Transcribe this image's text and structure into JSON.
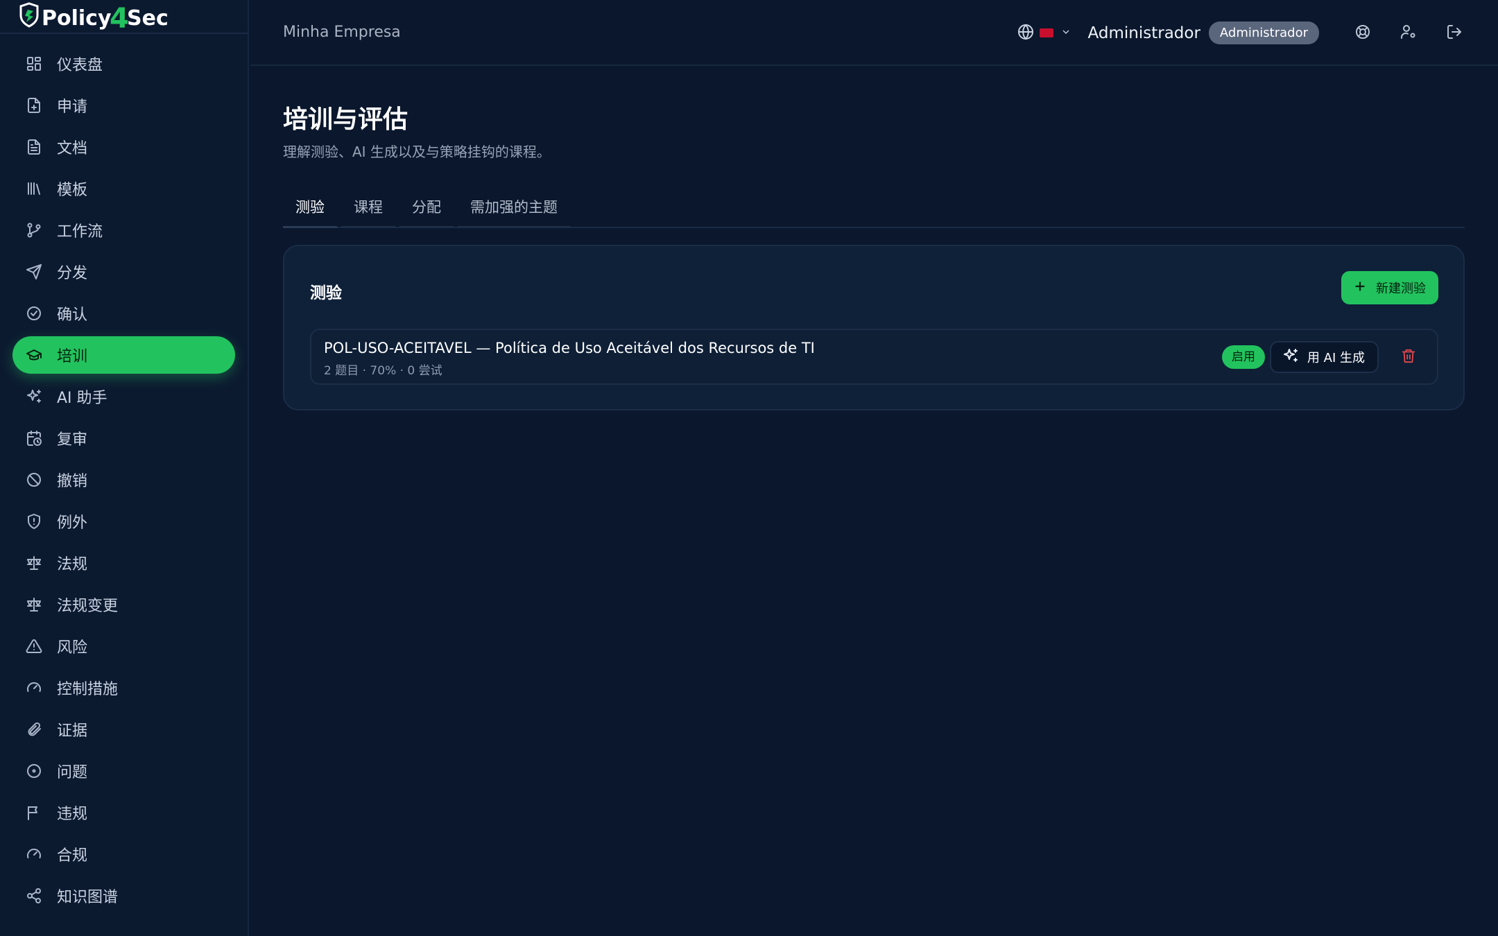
{
  "brand": {
    "name": "Policy4Sec",
    "part1": "Policy",
    "part2": "4",
    "part3": "Sec",
    "accent": "#22c35e"
  },
  "sidebar": {
    "items": [
      {
        "label": "仪表盘",
        "icon": "dashboard-icon"
      },
      {
        "label": "申请",
        "icon": "file-plus-icon"
      },
      {
        "label": "文档",
        "icon": "document-icon"
      },
      {
        "label": "模板",
        "icon": "library-icon"
      },
      {
        "label": "工作流",
        "icon": "git-branch-icon"
      },
      {
        "label": "分发",
        "icon": "send-icon"
      },
      {
        "label": "确认",
        "icon": "check-circle-icon"
      },
      {
        "label": "培训",
        "icon": "graduation-cap-icon",
        "active": true
      },
      {
        "label": "AI 助手",
        "icon": "sparkles-icon"
      },
      {
        "label": "复审",
        "icon": "calendar-clock-icon"
      },
      {
        "label": "撤销",
        "icon": "ban-icon"
      },
      {
        "label": "例外",
        "icon": "shield-alert-icon"
      },
      {
        "label": "法规",
        "icon": "scale-icon"
      },
      {
        "label": "法规变更",
        "icon": "scale-icon"
      },
      {
        "label": "风险",
        "icon": "warning-icon"
      },
      {
        "label": "控制措施",
        "icon": "gauge-icon"
      },
      {
        "label": "证据",
        "icon": "paperclip-icon"
      },
      {
        "label": "问题",
        "icon": "circle-dot-icon"
      },
      {
        "label": "违规",
        "icon": "flag-icon"
      },
      {
        "label": "合规",
        "icon": "gauge-icon"
      },
      {
        "label": "知识图谱",
        "icon": "share-icon"
      },
      {
        "label": "",
        "icon": "more-icon"
      }
    ]
  },
  "header": {
    "company": "Minha Empresa",
    "user_name": "Administrador",
    "role": "Administrador",
    "language_flag_color": "#c8102e"
  },
  "page": {
    "title": "培训与评估",
    "subtitle": "理解测验、AI 生成以及与策略挂钩的课程。"
  },
  "tabs": [
    {
      "label": "测验",
      "active": true
    },
    {
      "label": "课程"
    },
    {
      "label": "分配"
    },
    {
      "label": "需加强的主题"
    }
  ],
  "quizzes_card": {
    "title": "测验",
    "new_button": "新建测验",
    "items": [
      {
        "title": "POL-USO-ACEITAVEL — Política de Uso Aceitável dos Recursos de TI",
        "meta": "2 题目 · 70% · 0 尝试",
        "status": "启用",
        "ai_button": "用 AI 生成"
      }
    ]
  }
}
